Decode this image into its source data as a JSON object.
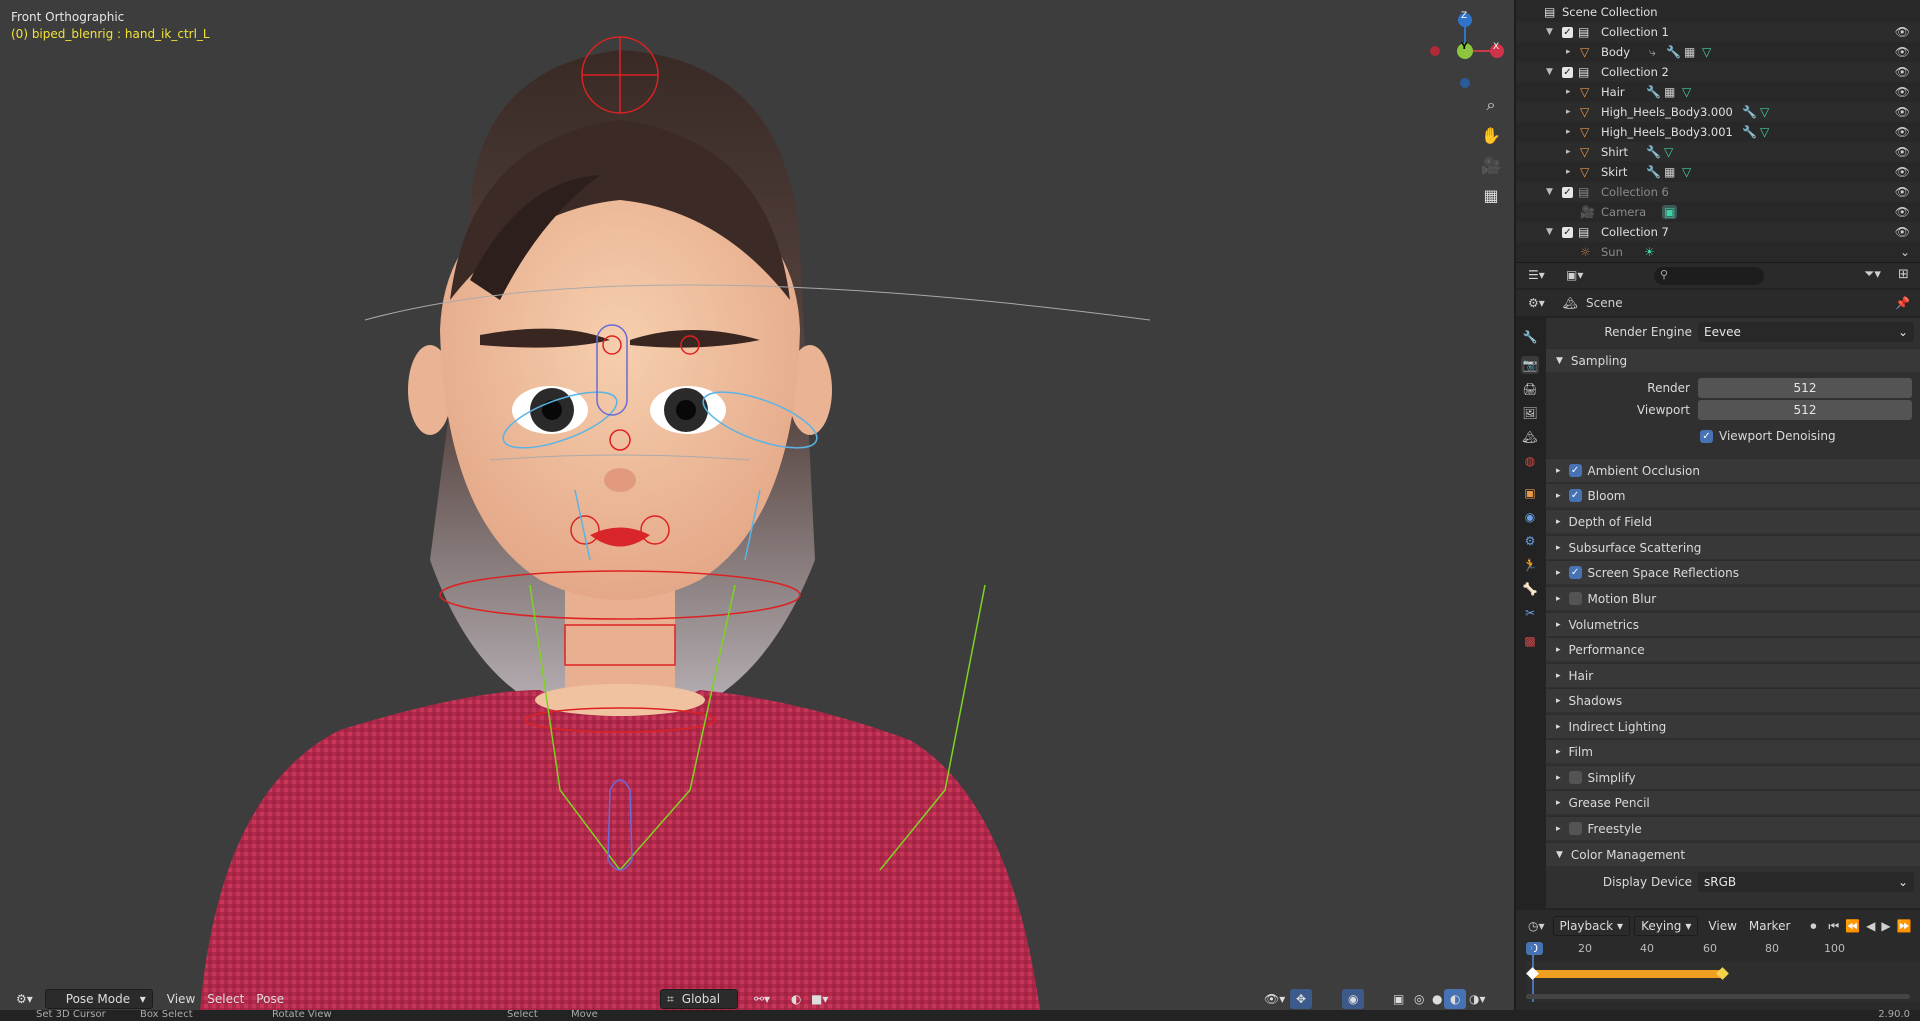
{
  "viewport": {
    "title": "Front Orthographic",
    "subtitle": "(0) biped_blenrig : hand_ik_ctrl_L",
    "gizmo": {
      "z": "Z",
      "y": "Y",
      "x": "X"
    },
    "header": {
      "mode": "Pose Mode",
      "menus": [
        "View",
        "Select",
        "Pose"
      ],
      "transform": "Global"
    },
    "side_icons": [
      "zoom-icon",
      "hand-icon",
      "camera-icon",
      "grid-icon"
    ]
  },
  "status": {
    "items": [
      "Set 3D Cursor",
      "Box Select",
      "Rotate View",
      "Select",
      "Move"
    ],
    "version": "2.90.0"
  },
  "outliner": {
    "root": "Scene Collection",
    "rows": [
      {
        "label": "Collection 1",
        "type": "collection"
      },
      {
        "label": "Body",
        "type": "mesh"
      },
      {
        "label": "Collection 2",
        "type": "collection"
      },
      {
        "label": "Hair",
        "type": "mesh"
      },
      {
        "label": "High_Heels_Body3.000",
        "type": "mesh"
      },
      {
        "label": "High_Heels_Body3.001",
        "type": "mesh"
      },
      {
        "label": "Shirt",
        "type": "mesh"
      },
      {
        "label": "Skirt",
        "type": "mesh"
      },
      {
        "label": "Collection 6",
        "type": "collection"
      },
      {
        "label": "Camera",
        "type": "camera"
      },
      {
        "label": "Collection 7",
        "type": "collection"
      },
      {
        "label": "Sun",
        "type": "light"
      }
    ]
  },
  "properties": {
    "context": "Scene",
    "render_engine_label": "Render Engine",
    "render_engine": "Eevee",
    "sampling": {
      "label": "Sampling",
      "render_label": "Render",
      "render": "512",
      "viewport_label": "Viewport",
      "viewport": "512",
      "denoise": "Viewport Denoising"
    },
    "sections": [
      {
        "label": "Ambient Occlusion",
        "cb": "on"
      },
      {
        "label": "Bloom",
        "cb": "on"
      },
      {
        "label": "Depth of Field",
        "cb": "none"
      },
      {
        "label": "Subsurface Scattering",
        "cb": "none"
      },
      {
        "label": "Screen Space Reflections",
        "cb": "on"
      },
      {
        "label": "Motion Blur",
        "cb": "off"
      },
      {
        "label": "Volumetrics",
        "cb": "none"
      },
      {
        "label": "Performance",
        "cb": "none"
      },
      {
        "label": "Hair",
        "cb": "none"
      },
      {
        "label": "Shadows",
        "cb": "none"
      },
      {
        "label": "Indirect Lighting",
        "cb": "none"
      },
      {
        "label": "Film",
        "cb": "none"
      },
      {
        "label": "Simplify",
        "cb": "off"
      },
      {
        "label": "Grease Pencil",
        "cb": "none"
      },
      {
        "label": "Freestyle",
        "cb": "off"
      }
    ],
    "color_management": {
      "label": "Color Management",
      "display_device_label": "Display Device",
      "display_device": "sRGB"
    }
  },
  "timeline": {
    "menus": [
      "Playback",
      "Keying",
      "View",
      "Marker"
    ],
    "current_frame": "0",
    "ticks": [
      "20",
      "40",
      "60",
      "80",
      "100"
    ]
  }
}
